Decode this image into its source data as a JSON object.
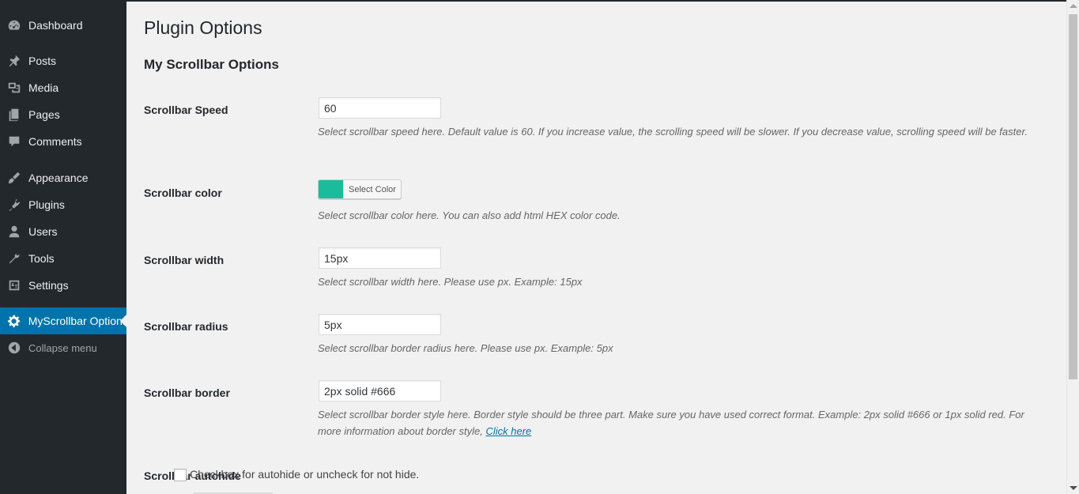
{
  "sidebar": {
    "items": [
      {
        "label": "Dashboard",
        "icon": "dashboard-icon"
      },
      {
        "label": "Posts",
        "icon": "pin-icon"
      },
      {
        "label": "Media",
        "icon": "media-icon"
      },
      {
        "label": "Pages",
        "icon": "pages-icon"
      },
      {
        "label": "Comments",
        "icon": "comments-icon"
      },
      {
        "label": "Appearance",
        "icon": "brush-icon"
      },
      {
        "label": "Plugins",
        "icon": "plugin-icon"
      },
      {
        "label": "Users",
        "icon": "user-icon"
      },
      {
        "label": "Tools",
        "icon": "wrench-icon"
      },
      {
        "label": "Settings",
        "icon": "settings-icon"
      },
      {
        "label": "MyScrollbar Options",
        "icon": "gear-icon",
        "active": true
      }
    ],
    "collapse_label": "Collapse menu"
  },
  "page": {
    "title": "Plugin Options",
    "section_title": "My Scrollbar Options"
  },
  "fields": {
    "speed": {
      "label": "Scrollbar Speed",
      "value": "60",
      "description": "Select scrollbar speed here. Default value is 60. If you increase value, the scrolling speed will be slower. If you decrease value, scrolling speed will be faster."
    },
    "color": {
      "label": "Scrollbar color",
      "button_label": "Select Color",
      "swatch_color": "#1abc9c",
      "description": "Select scrollbar color here. You can also add html HEX color code."
    },
    "width": {
      "label": "Scrollbar width",
      "value": "15px",
      "description": "Select scrollbar width here. Please use px. Example: 15px"
    },
    "radius": {
      "label": "Scrollbar radius",
      "value": "5px",
      "description": "Select scrollbar border radius here. Please use px. Example: 5px"
    },
    "border": {
      "label": "Scrollbar border",
      "value": "2px solid #666",
      "description": "Select scrollbar border style here. Border style should be three part. Make sure you have used correct format. Example: 2px solid #666 or 1px solid red. For more information about border style,",
      "link_label": "Click here"
    },
    "autohide": {
      "label": "Scrollbar autohide",
      "checked": false,
      "checkbox_label": "Checkbox for autohide or uncheck for not hide."
    }
  },
  "colors": {
    "sidebar_bg": "#23282d",
    "active_bg": "#0073aa",
    "page_bg": "#f1f1f1",
    "link": "#0073aa"
  }
}
